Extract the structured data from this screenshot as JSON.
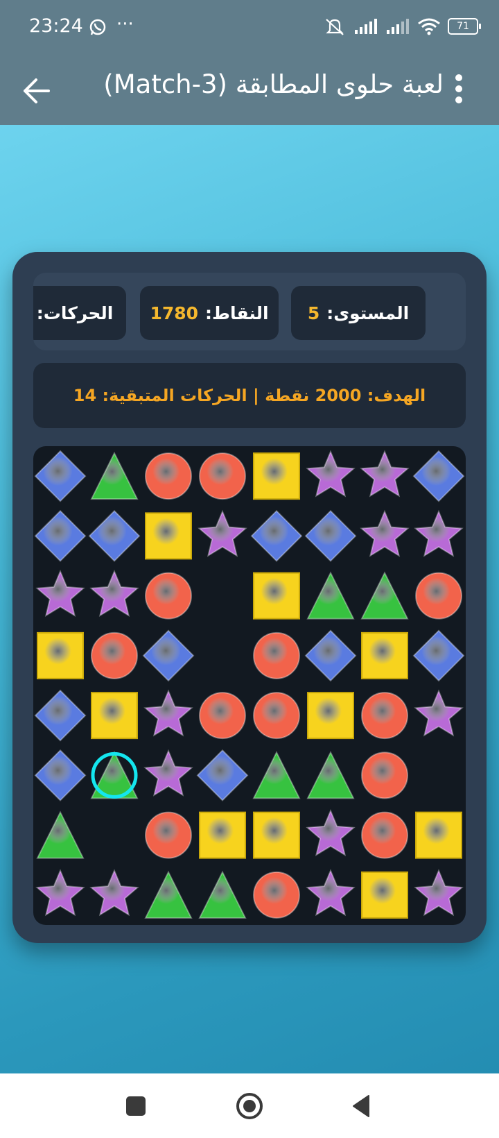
{
  "status_bar": {
    "time": "23:24",
    "battery": "71",
    "icons": [
      "whatsapp-icon",
      "more-icon",
      "mute-icon",
      "signal-icon",
      "signal-icon",
      "wifi-icon",
      "battery-icon"
    ]
  },
  "app_bar": {
    "title": "لعبة حلوى المطابقة (Match-3)",
    "back_icon": "arrow-back-icon",
    "menu_icon": "more-vert-icon"
  },
  "stats": {
    "level_label": "المستوى:",
    "level_value": "5",
    "score_label": "النقاط:",
    "score_value": "1780",
    "moves_label": "الحركات:",
    "moves_value": "14"
  },
  "goal_text": "الهدف: 2000 نقطة | الحركات المتبقية: 14",
  "board": {
    "rows": 8,
    "cols": 8,
    "selected": [
      5,
      1
    ],
    "cells": [
      [
        "diamond",
        "triangle",
        "circle",
        "circle",
        "square",
        "star",
        "star",
        "diamond"
      ],
      [
        "diamond",
        "diamond",
        "square",
        "star",
        "diamond",
        "diamond",
        "star",
        "star"
      ],
      [
        "star",
        "star",
        "circle",
        "",
        "square",
        "triangle",
        "triangle",
        "circle"
      ],
      [
        "square",
        "circle",
        "diamond",
        "",
        "circle",
        "diamond",
        "square",
        "diamond"
      ],
      [
        "diamond",
        "square",
        "star",
        "circle",
        "circle",
        "square",
        "circle",
        "star"
      ],
      [
        "diamond",
        "triangle",
        "star",
        "diamond",
        "triangle",
        "triangle",
        "circle",
        ""
      ],
      [
        "triangle",
        "",
        "circle",
        "square",
        "square",
        "star",
        "circle",
        "square"
      ],
      [
        "star",
        "star",
        "triangle",
        "triangle",
        "circle",
        "star",
        "square",
        "star"
      ]
    ],
    "colors": {
      "diamond": "#5a7be0",
      "triangle": "#37c240",
      "circle": "#f2634b",
      "square": "#f7d31e",
      "star": "#b86ad6"
    }
  },
  "nav_bar": {
    "buttons": [
      "recents-icon",
      "home-icon",
      "back-icon"
    ]
  }
}
